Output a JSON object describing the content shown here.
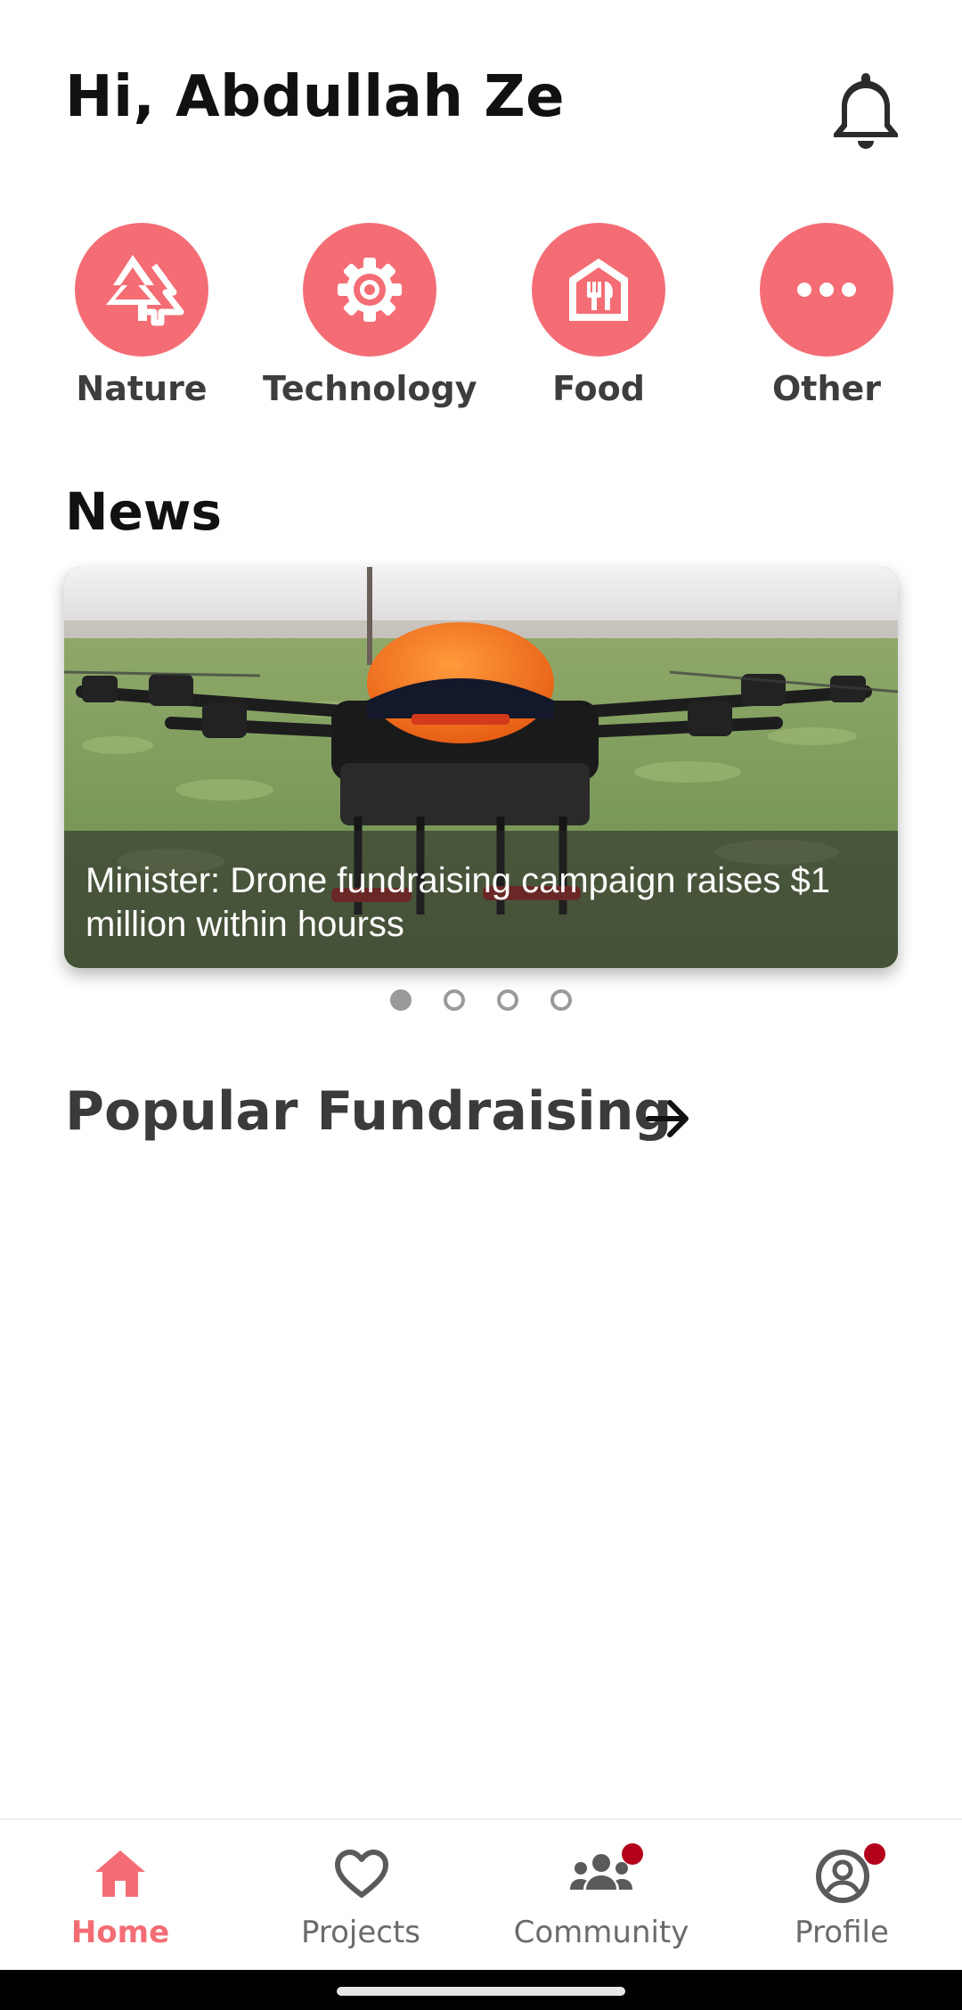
{
  "header": {
    "greeting": "Hi, Abdullah Ze",
    "notification_icon": "bell-icon"
  },
  "categories": [
    {
      "label": "Nature",
      "icon": "trees-icon"
    },
    {
      "label": "Technology",
      "icon": "gear-icon"
    },
    {
      "label": "Food",
      "icon": "restaurant-icon"
    },
    {
      "label": "Other",
      "icon": "more-dots-icon"
    }
  ],
  "news": {
    "title": "News",
    "slides": [
      {
        "caption": "Minister: Drone fundraising campaign raises $1 million within hourss",
        "image": "drone over crop field"
      }
    ],
    "slide_count": 4,
    "active_slide": 1
  },
  "popular": {
    "title": "Popular Fundraising",
    "arrow_icon": "arrow-right-icon"
  },
  "bottom_nav": [
    {
      "label": "Home",
      "icon": "home-icon",
      "active": true,
      "badge": false
    },
    {
      "label": "Projects",
      "icon": "heart-icon",
      "active": false,
      "badge": false
    },
    {
      "label": "Community",
      "icon": "group-icon",
      "active": false,
      "badge": true
    },
    {
      "label": "Profile",
      "icon": "profile-icon",
      "active": false,
      "badge": true
    }
  ],
  "colors": {
    "accent": "#F46D75",
    "badge": "#b3001b",
    "text_dark": "#111111",
    "text_muted": "#6b6b6b"
  }
}
